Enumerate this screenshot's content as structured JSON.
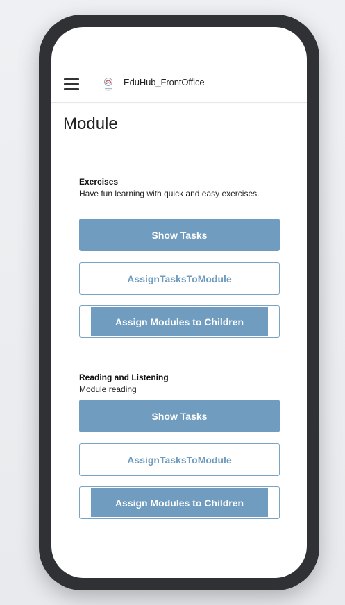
{
  "header": {
    "app_title": "EduHub_FrontOffice"
  },
  "page": {
    "title": "Module"
  },
  "modules": [
    {
      "title": "Exercises",
      "description": "Have fun learning with quick and easy exercises.",
      "show_tasks_label": "Show Tasks",
      "assign_tasks_label": "AssignTasksToModule",
      "assign_children_label": "Assign Modules to Children"
    },
    {
      "title": "Reading and Listening",
      "description": "Module reading",
      "show_tasks_label": "Show Tasks",
      "assign_tasks_label": "AssignTasksToModule",
      "assign_children_label": "Assign Modules to Children"
    }
  ],
  "colors": {
    "accent": "#6f9cbf",
    "phone_frame": "#2f3134",
    "background": "#ffffff"
  },
  "icons": {
    "menu": "hamburger-menu-icon",
    "logo": "eduhub-logo-icon"
  }
}
